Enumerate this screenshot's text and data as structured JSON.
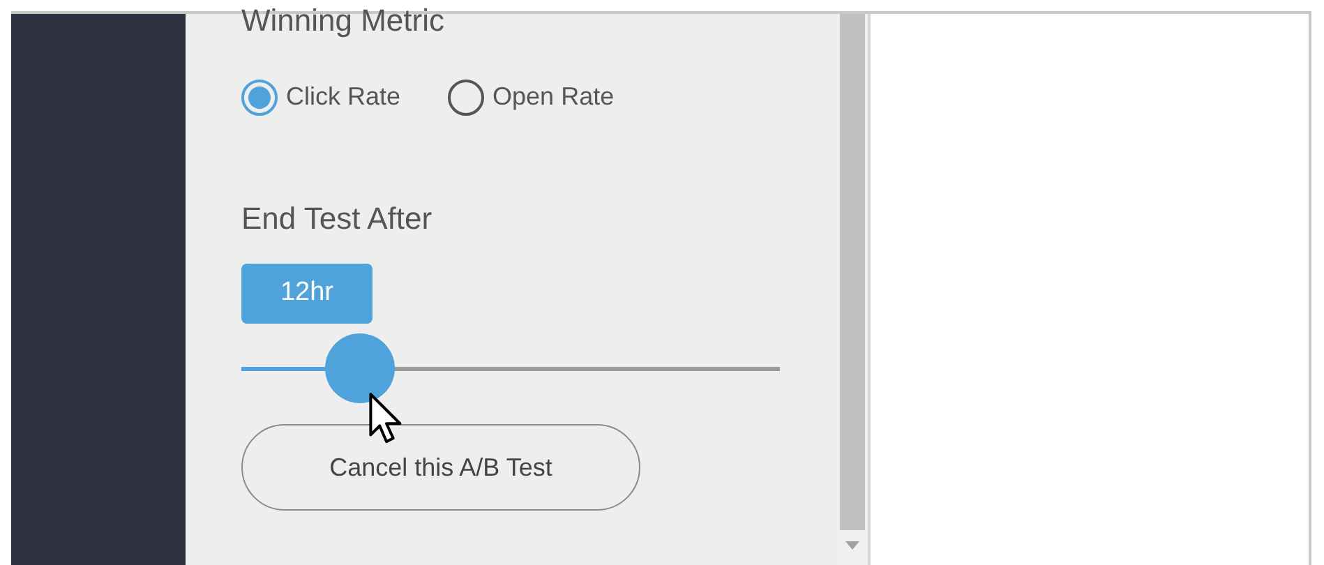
{
  "winning_metric": {
    "title": "Winning Metric",
    "options": [
      {
        "label": "Click Rate",
        "selected": true
      },
      {
        "label": "Open Rate",
        "selected": false
      }
    ]
  },
  "end_test_after": {
    "title": "End Test After",
    "value": "12hr",
    "level": 0.22
  },
  "cancel_button": "Cancel this A/B Test"
}
